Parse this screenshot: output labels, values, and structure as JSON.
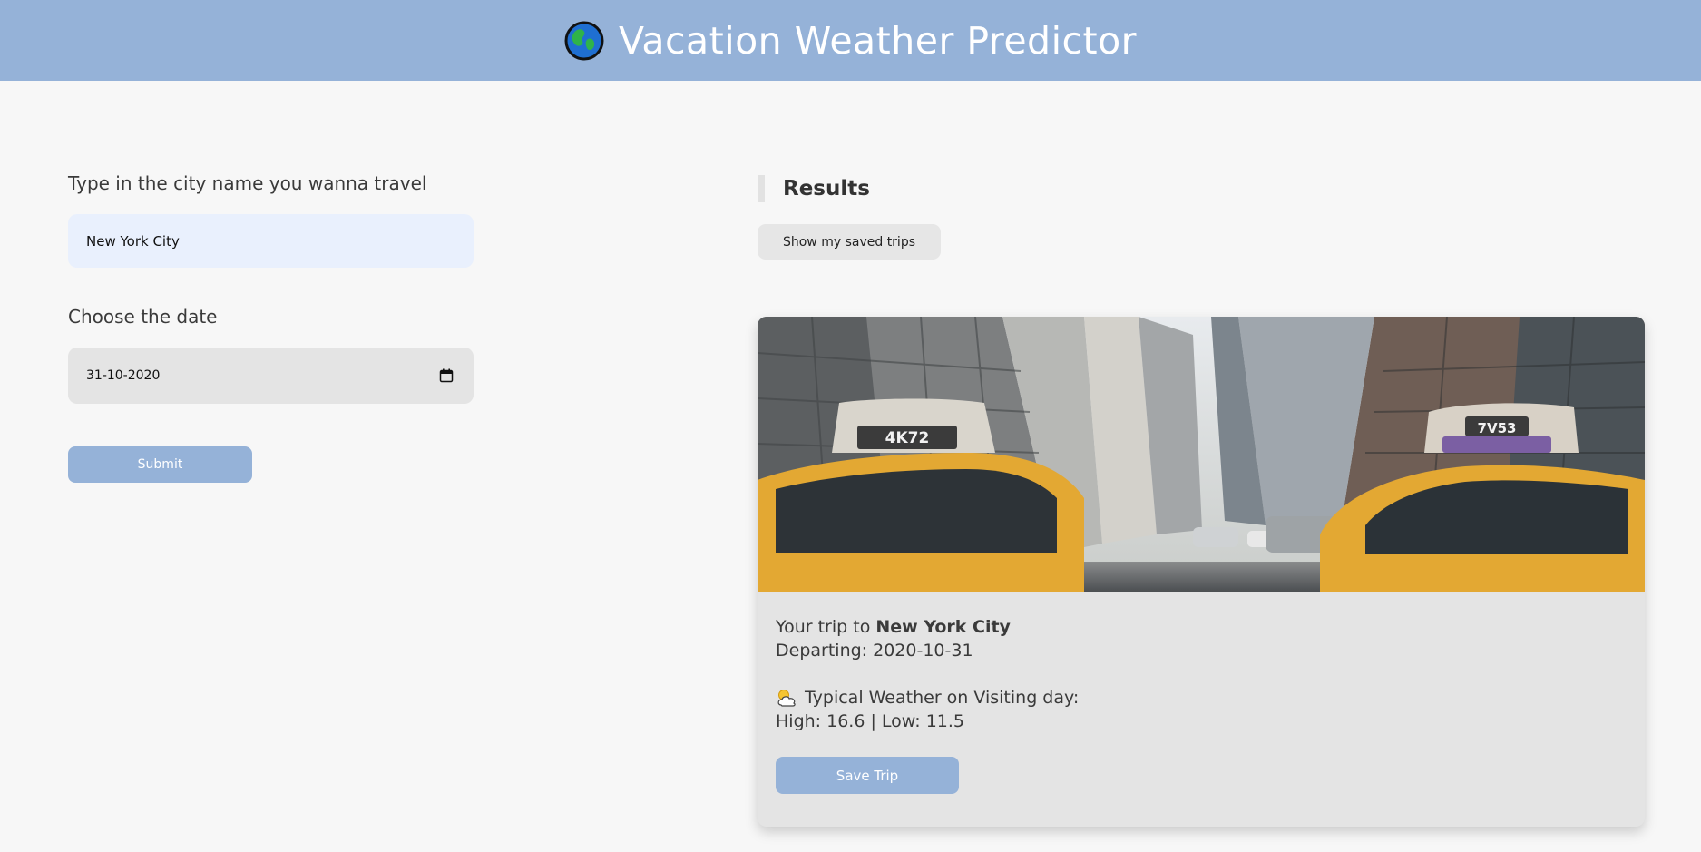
{
  "header": {
    "title": "Vacation Weather Predictor",
    "icon": "globe-icon"
  },
  "form": {
    "city_label": "Type in the city name you wanna travel",
    "city_value": "New York City",
    "date_label": "Choose the date",
    "date_value": "31-10-2020",
    "submit_label": "Submit"
  },
  "results": {
    "title": "Results",
    "saved_trips_label": "Show my saved trips"
  },
  "trip_card": {
    "photo_subject": "new-york-city-street-photo",
    "taxi_left_number": "4K72",
    "taxi_right_number": "7V53",
    "trip_prefix": "Your trip to",
    "city": "New York City",
    "departing": "Departing: 2020-10-31",
    "weather_heading": "Typical Weather on Visiting day:",
    "high_low": "High: 16.6 | Low: 11.5",
    "save_label": "Save Trip"
  },
  "colors": {
    "header_bg": "#95b2d8",
    "page_bg": "#f7f7f7",
    "city_input_bg": "#e9f0fd",
    "card_bg": "#e4e4e4",
    "button_bg": "#95b2d8"
  }
}
